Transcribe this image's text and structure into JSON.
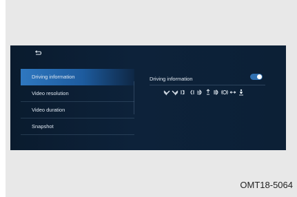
{
  "screen": {
    "back_icon": "back-arrow-icon",
    "menu": [
      {
        "label": "Driving information",
        "active": true
      },
      {
        "label": "Video resolution",
        "active": false
      },
      {
        "label": "Video duration",
        "active": false
      },
      {
        "label": "Snapshot",
        "active": false
      }
    ],
    "detail": {
      "title": "Driving information",
      "toggle_on": true,
      "indicator_icons": [
        "turn-left-icon",
        "turn-right-icon",
        "fog-light-icon",
        "rear-fog-icon",
        "low-beam-icon",
        "front-fog-icon",
        "high-beam-icon",
        "brake-warning-icon",
        "hazard-arrows-icon",
        "seatbelt-icon"
      ]
    }
  },
  "figure_code": "OMT18-5064",
  "colors": {
    "screen_bg": "#0c2036",
    "accent": "#2f78c0",
    "frame_bg": "#e8e8e8"
  }
}
